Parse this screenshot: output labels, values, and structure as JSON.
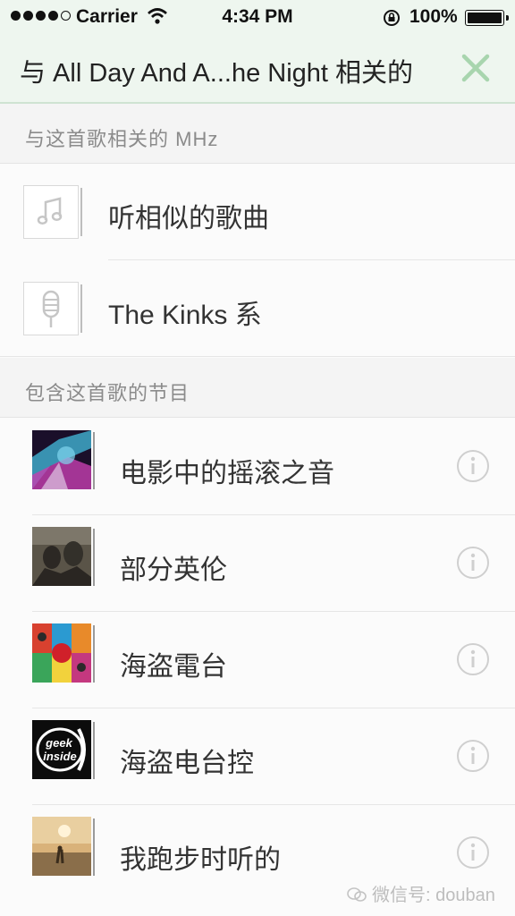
{
  "status_bar": {
    "carrier": "Carrier",
    "time": "4:34 PM",
    "battery": "100%"
  },
  "nav": {
    "title": "与 All Day And A...he Night 相关的"
  },
  "section_mhz": {
    "title": "与这首歌相关的 MHz"
  },
  "mhz_items": [
    {
      "label": "听相似的歌曲",
      "icon": "music-note-icon"
    },
    {
      "label": "The Kinks 系",
      "icon": "microphone-icon"
    }
  ],
  "section_programs": {
    "title": "包含这首歌的节目"
  },
  "programs": [
    {
      "label": "电影中的摇滚之音"
    },
    {
      "label": " 部分英伦"
    },
    {
      "label": "海盗電台"
    },
    {
      "label": "海盗电台控"
    },
    {
      "label": "我跑步时听的"
    }
  ],
  "cover_badges": {
    "geek": "geek",
    "inside": "inside"
  },
  "watermark": "微信号: douban",
  "colors": {
    "nav_bg": "#eef6ef",
    "accent_green": "#a8d5ae"
  }
}
